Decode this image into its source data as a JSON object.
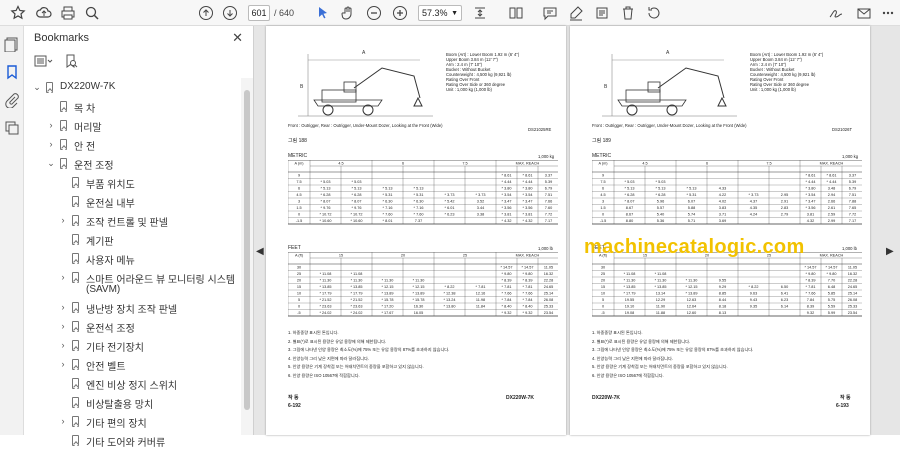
{
  "toolbar": {
    "page_current": "601",
    "page_total": "/ 640",
    "zoom": "57.3%"
  },
  "panel": {
    "title": "Bookmarks",
    "items": [
      {
        "label": "DX220W-7K",
        "level": 0,
        "state": "expanded"
      },
      {
        "label": "목 차",
        "level": 1,
        "state": "leaf"
      },
      {
        "label": "머리말",
        "level": 1,
        "state": "collapsed"
      },
      {
        "label": "안 전",
        "level": 1,
        "state": "collapsed"
      },
      {
        "label": "운전 조정",
        "level": 1,
        "state": "expanded"
      },
      {
        "label": "부품 위치도",
        "level": 2,
        "state": "leaf"
      },
      {
        "label": "운전실 내부",
        "level": 2,
        "state": "leaf"
      },
      {
        "label": "조작 컨트롤 및 판넬",
        "level": 2,
        "state": "collapsed"
      },
      {
        "label": "계기판",
        "level": 2,
        "state": "leaf"
      },
      {
        "label": "사용자 메뉴",
        "level": 2,
        "state": "leaf"
      },
      {
        "label": "스마트 어라운드 뷰 모니터링 시스템",
        "label2": "(SAVM)",
        "level": 2,
        "state": "collapsed"
      },
      {
        "label": "냉난방 장치 조작 판넬",
        "level": 2,
        "state": "collapsed"
      },
      {
        "label": "운전석 조정",
        "level": 2,
        "state": "collapsed"
      },
      {
        "label": "기타 전기장치",
        "level": 2,
        "state": "collapsed"
      },
      {
        "label": "안전 벨트",
        "level": 2,
        "state": "collapsed"
      },
      {
        "label": "엔진 비상 정지 스위치",
        "level": 2,
        "state": "leaf"
      },
      {
        "label": "비상탈출용 망치",
        "level": 2,
        "state": "leaf"
      },
      {
        "label": "기타 편의 장치",
        "level": 2,
        "state": "collapsed"
      },
      {
        "label": "기타 도어와 커버류",
        "level": 2,
        "state": "leaf"
      }
    ]
  },
  "left_page": {
    "spec_lines": [
      "Boom (Art)   : Lower Boom 1.92 m (6' 4\")",
      "Upper Boom 3.84 m (12' 7\")",
      "Arm          : 2.4 m (7' 10\")",
      "Bucket       : Without Bucket",
      "Counterweight : 4,500 kg (9,921 lb)",
      "Rating Over Front",
      "Rating Over Side or 360 degree",
      "Unit         : 1,000 kg (1,000 lb)"
    ],
    "caption_footer": "Front : Outrigger, Rear : Outrigger, Under-Mount Dozer, Looking at the Front (Wide)",
    "figure_id": "DS21025RE",
    "figure_label": "그림 188",
    "metric_label": "METRIC",
    "metric_unit": "1,000 kg",
    "feet_label": "FEET",
    "feet_unit": "1,000 lb",
    "metric_headers": [
      "A (m)",
      "4.5",
      "6",
      "7.5",
      "MAX. REACH"
    ],
    "metric_rows": [
      [
        "9",
        "",
        "",
        "",
        "",
        "",
        "",
        "* 8.61",
        "* 8.61",
        "3.37"
      ],
      [
        "7.5",
        "* 5.03",
        "* 5.03",
        "",
        "",
        "",
        "",
        "* 4.44",
        "* 4.44",
        "5.39"
      ],
      [
        "6",
        "* 5.13",
        "* 5.13",
        "* 5.13",
        "* 5.13",
        "",
        "",
        "* 3.80",
        "* 3.80",
        "6.79"
      ],
      [
        "4.5",
        "* 6.28",
        "* 6.28",
        "* 5.31",
        "* 5.31",
        "* 3.73",
        "* 3.73",
        "* 3.54",
        "* 3.54",
        "7.51"
      ],
      [
        "3",
        "* 8.07",
        "* 8.07",
        "* 6.30",
        "* 6.30",
        "* 5.42",
        "3.52",
        "* 3.47",
        "* 3.47",
        "7.66"
      ],
      [
        "1.5",
        "* 9.76",
        "* 9.76",
        "* 7.16",
        "* 7.16",
        "* 6.01",
        "3.44",
        "* 3.56",
        "* 3.56",
        "7.60"
      ],
      [
        "0",
        "* 10.72",
        "* 10.72",
        "* 7.60",
        "* 7.60",
        "* 6.23",
        "3.38",
        "* 3.81",
        "* 3.81",
        "7.72"
      ],
      [
        "-1.5",
        "* 10.60",
        "* 10.60",
        "* 8.01",
        "7.37",
        "",
        "",
        "* 4.32",
        "* 4.32",
        "7.17"
      ]
    ],
    "feet_headers": [
      "A (ft)",
      "15",
      "20",
      "25",
      "MAX. REACH"
    ],
    "feet_rows": [
      [
        "30",
        "",
        "",
        "",
        "",
        "",
        "",
        "* 14.57",
        "* 14.57",
        "11.05"
      ],
      [
        "25",
        "* 11.08",
        "* 11.08",
        "",
        "",
        "",
        "",
        "* 9.80",
        "* 9.80",
        "16.32"
      ],
      [
        "20",
        "* 11.30",
        "* 11.30",
        "* 11.30",
        "* 11.30",
        "",
        "",
        "* 8.39",
        "* 8.39",
        "22.28"
      ],
      [
        "15",
        "* 13.85",
        "* 13.85",
        "* 12.15",
        "* 12.15",
        "* 8.22",
        "* 7.81",
        "* 7.81",
        "* 7.81",
        "24.65"
      ],
      [
        "10",
        "* 17.79",
        "* 17.79",
        "* 13.89",
        "* 13.89",
        "* 12.38",
        "12.16",
        "* 7.66",
        "* 7.66",
        "25.14"
      ],
      [
        "5",
        "* 21.52",
        "* 21.52",
        "* 15.78",
        "* 15.78",
        "* 13.24",
        "11.98",
        "* 7.84",
        "* 7.84",
        "26.08"
      ],
      [
        "0",
        "* 23.63",
        "* 23.63",
        "* 17.20",
        "16.30",
        "* 13.80",
        "11.84",
        "* 8.40",
        "* 8.40",
        "25.33"
      ],
      [
        "-5",
        "* 24.02",
        "* 24.02",
        "* 17.67",
        "16.05",
        "",
        "",
        "* 9.32",
        "* 9.32",
        "23.54"
      ]
    ],
    "notes": [
      "1. 하중중량 표시된 톤입니다.",
      "2. 별표(*)로 표시된 용량은 유압 용량에 의해 제한됩니다.",
      "3. 그림에 나타낸 인양 용량은 최소도(%)에 75% 또는 유압 용량의 87%를 초과하지 않습니다.",
      "4. 인양능력 그리 낮은 지면에 따라 달라집니다.",
      "5. 인양 용량은 기계 장착점 또는 어태치먼트의 중량을 포함하고 있지 않습니다.",
      "6. 인양 용량은 ISO 10567에 적합합니다."
    ],
    "footer_left_top": "작 동",
    "footer_left_bottom": "6-192",
    "footer_right": "DX220W-7K"
  },
  "right_page": {
    "spec_lines": [
      "Boom (Art)   : Lower Boom 1.92 m (6' 4\")",
      "Upper Boom 3.84 m (12' 7\")",
      "Arm          : 2.4 m (7' 10\")",
      "Bucket       : Without Bucket",
      "Counterweight : 4,500 kg (9,921 lb)",
      "Rating Over Front",
      "Rating Over Side or 360 degree",
      "Unit         : 1,000 kg (1,000 lb)"
    ],
    "caption_footer": "Front : Outrigger, Rear : Outrigger, Under-Mount Dozer, Looking at the Front (Wide)",
    "figure_id": "DS21026T",
    "figure_label": "그림 189",
    "metric_label": "METRIC",
    "metric_unit": "1,000 kg",
    "feet_label": "FEET",
    "feet_unit": "1,000 lb",
    "metric_headers": [
      "A (m)",
      "4.5",
      "6",
      "7.5",
      "MAX. REACH"
    ],
    "metric_rows": [
      [
        "9",
        "",
        "",
        "",
        "",
        "",
        "",
        "* 8.61",
        "* 8.61",
        "3.37"
      ],
      [
        "7.5",
        "* 5.03",
        "* 5.03",
        "",
        "",
        "",
        "",
        "* 4.44",
        "* 4.44",
        "5.39"
      ],
      [
        "6",
        "* 5.13",
        "* 5.13",
        "* 5.13",
        "4.33",
        "",
        "",
        "* 3.80",
        "3.48",
        "6.79"
      ],
      [
        "4.5",
        "* 6.28",
        "* 6.28",
        "* 5.31",
        "4.22",
        "* 3.73",
        "2.95",
        "* 3.54",
        "2.94",
        "7.51"
      ],
      [
        "3",
        "* 8.07",
        "5.96",
        "6.07",
        "4.02",
        "4.37",
        "2.91",
        "* 3.47",
        "2.66",
        "7.88"
      ],
      [
        "1.5",
        "8.67",
        "5.57",
        "5.88",
        "3.83",
        "4.35",
        "2.83",
        "* 3.56",
        "2.61",
        "7.65"
      ],
      [
        "0",
        "8.67",
        "5.40",
        "5.74",
        "3.71",
        "4.24",
        "2.79",
        "3.81",
        "2.59",
        "7.72"
      ],
      [
        "-1.5",
        "8.80",
        "5.36",
        "5.71",
        "3.69",
        "",
        "",
        "4.32",
        "2.99",
        "7.17"
      ]
    ],
    "feet_headers": [
      "A (ft)",
      "15",
      "20",
      "25",
      "MAX. REACH"
    ],
    "feet_rows": [
      [
        "30",
        "",
        "",
        "",
        "",
        "",
        "",
        "* 14.57",
        "* 14.57",
        "11.05"
      ],
      [
        "25",
        "* 11.08",
        "* 11.08",
        "",
        "",
        "",
        "",
        "* 9.80",
        "* 9.80",
        "16.32"
      ],
      [
        "20",
        "* 11.30",
        "* 11.30",
        "* 11.30",
        "9.55",
        "",
        "",
        "* 8.39",
        "7.70",
        "22.28"
      ],
      [
        "15",
        "* 13.85",
        "* 13.85",
        "* 12.15",
        "9.29",
        "* 8.22",
        "6.50",
        "* 7.81",
        "6.48",
        "24.65"
      ],
      [
        "10",
        "* 17.79",
        "13.14",
        "* 13.89",
        "8.85",
        "9.63",
        "6.41",
        "* 7.66",
        "5.85",
        "25.14"
      ],
      [
        "5",
        "19.55",
        "12.29",
        "12.63",
        "8.44",
        "9.43",
        "6.23",
        "7.84",
        "5.75",
        "26.08"
      ],
      [
        "0",
        "19.10",
        "11.90",
        "12.64",
        "8.18",
        "9.35",
        "6.14",
        "8.39",
        "5.59",
        "25.33"
      ],
      [
        "-5",
        "19.08",
        "11.88",
        "12.60",
        "8.13",
        "",
        "",
        "9.32",
        "5.99",
        "23.54"
      ]
    ],
    "notes": [
      "1. 하중중량 표시된 톤입니다.",
      "2. 별표(*)로 표시된 용량은 유압 용량에 의해 제한됩니다.",
      "3. 그림에 나타낸 인양 용량은 최소도(%)에 75% 또는 유압 용량의 87%를 초과하지 않습니다.",
      "4. 인양능력 그리 낮은 지면에 따라 달라집니다.",
      "5. 인양 용량은 기계 장착점 또는 어태치먼트의 중량을 포함하고 있지 않습니다.",
      "6. 인양 용량은 ISO 10567에 적합합니다."
    ],
    "footer_left_top": "DX220W-7K",
    "footer_right_top": "작 동",
    "footer_right_bottom": "6-193"
  },
  "watermark": "machinecatalogic.com"
}
